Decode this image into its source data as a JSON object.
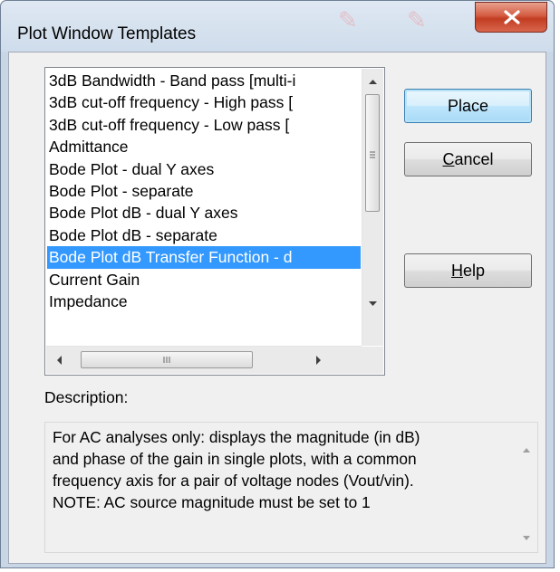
{
  "window": {
    "title": "Plot Window Templates",
    "close_label": "X"
  },
  "templates": {
    "items": [
      {
        "label": "3dB Bandwidth - Band pass [multi-i"
      },
      {
        "label": "3dB cut-off frequency - High pass ["
      },
      {
        "label": "3dB cut-off frequency - Low pass ["
      },
      {
        "label": "Admittance"
      },
      {
        "label": "Bode Plot - dual Y axes"
      },
      {
        "label": "Bode Plot - separate"
      },
      {
        "label": "Bode Plot dB - dual Y axes"
      },
      {
        "label": "Bode Plot dB - separate"
      },
      {
        "label": "Bode Plot dB Transfer Function - d"
      },
      {
        "label": "Current Gain"
      },
      {
        "label": "Impedance"
      }
    ],
    "selected_index": 8
  },
  "buttons": {
    "place": "Place",
    "cancel_mnemonic": "C",
    "cancel_rest": "ancel",
    "help_mnemonic": "H",
    "help_rest": "elp"
  },
  "description": {
    "label": "Description:",
    "text": "For AC analyses only: displays the magnitude (in dB)\nand phase of the gain in single plots, with a common\nfrequency axis for a pair of voltage nodes (Vout/vin).\n NOTE: AC source magnitude must be set to 1"
  },
  "colors": {
    "selection": "#3399ff",
    "close_button": "#c94a30"
  },
  "icons": [
    "close-icon",
    "scroll-up-icon",
    "scroll-down-icon",
    "scroll-left-icon",
    "scroll-right-icon",
    "thumb-grip-icon"
  ]
}
